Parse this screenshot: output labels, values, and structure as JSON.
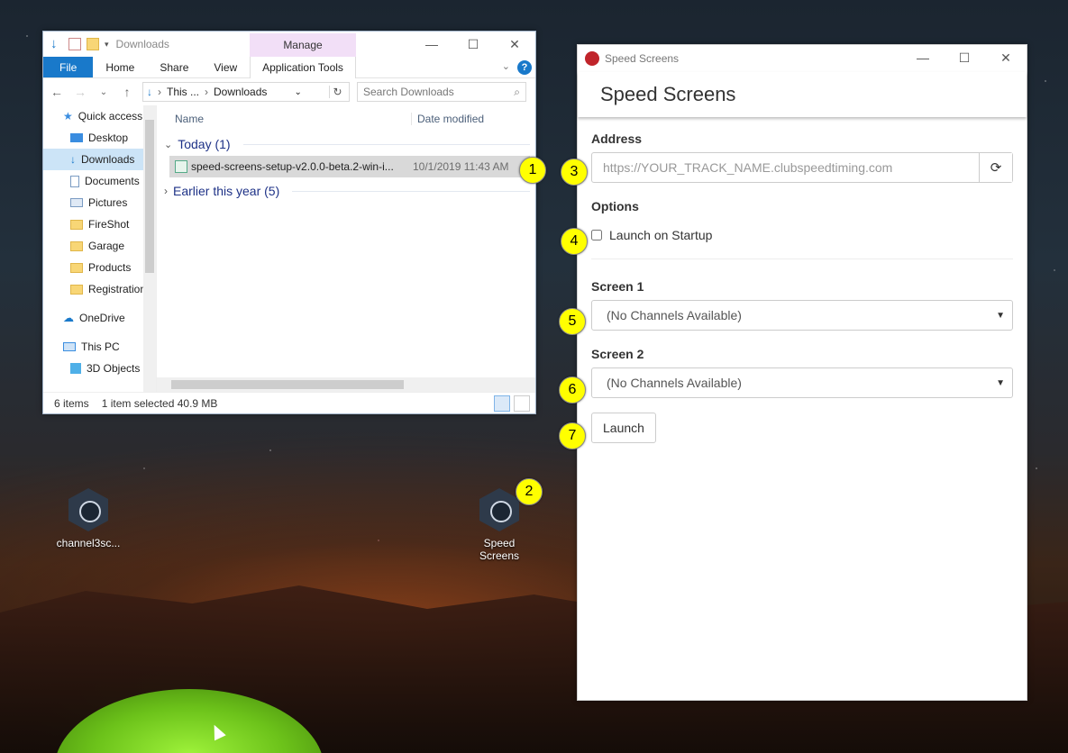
{
  "explorer": {
    "title": "Downloads",
    "contextual_tab": "Manage",
    "ribbon_tabs": [
      "File",
      "Home",
      "Share",
      "View",
      "Application Tools"
    ],
    "address": {
      "part1": "This ...",
      "part2": "Downloads"
    },
    "search_placeholder": "Search Downloads",
    "nav_items": [
      {
        "label": "Quick access",
        "icon": "star-icon"
      },
      {
        "label": "Desktop",
        "icon": "desktop-icon"
      },
      {
        "label": "Downloads",
        "icon": "download-icon"
      },
      {
        "label": "Documents",
        "icon": "documents-icon"
      },
      {
        "label": "Pictures",
        "icon": "pictures-icon"
      },
      {
        "label": "FireShot",
        "icon": "folder-icon"
      },
      {
        "label": "Garage",
        "icon": "folder-icon"
      },
      {
        "label": "Products",
        "icon": "folder-icon"
      },
      {
        "label": "Registration",
        "icon": "folder-icon"
      },
      {
        "label": "OneDrive",
        "icon": "cloud-icon"
      },
      {
        "label": "This PC",
        "icon": "computer-icon"
      },
      {
        "label": "3D Objects",
        "icon": "cube-icon"
      }
    ],
    "columns": {
      "name": "Name",
      "date": "Date modified"
    },
    "groups": [
      {
        "label": "Today (1)"
      },
      {
        "label": "Earlier this year (5)"
      }
    ],
    "file": {
      "name": "speed-screens-setup-v2.0.0-beta.2-win-i...",
      "date": "10/1/2019 11:43 AM"
    },
    "status": {
      "count": "6 items",
      "selected": "1 item selected  40.9 MB"
    }
  },
  "speed_screens": {
    "window_title": "Speed Screens",
    "header": "Speed Screens",
    "address_label": "Address",
    "address_placeholder": "https://YOUR_TRACK_NAME.clubspeedtiming.com",
    "options_label": "Options",
    "startup_label": "Launch on Startup",
    "screen1_label": "Screen 1",
    "screen1_value": "(No Channels Available)",
    "screen2_label": "Screen 2",
    "screen2_value": "(No Channels Available)",
    "launch_label": "Launch"
  },
  "desktop": {
    "icon1_label": "channel3sc...",
    "icon2_label_line1": "Speed",
    "icon2_label_line2": "Screens"
  },
  "callouts": [
    "1",
    "2",
    "3",
    "4",
    "5",
    "6",
    "7"
  ],
  "colors": {
    "callout": "#ffff00",
    "file_tab": "#1979ca",
    "manage_tab": "#f2dff7",
    "group_text": "#1e3287"
  }
}
